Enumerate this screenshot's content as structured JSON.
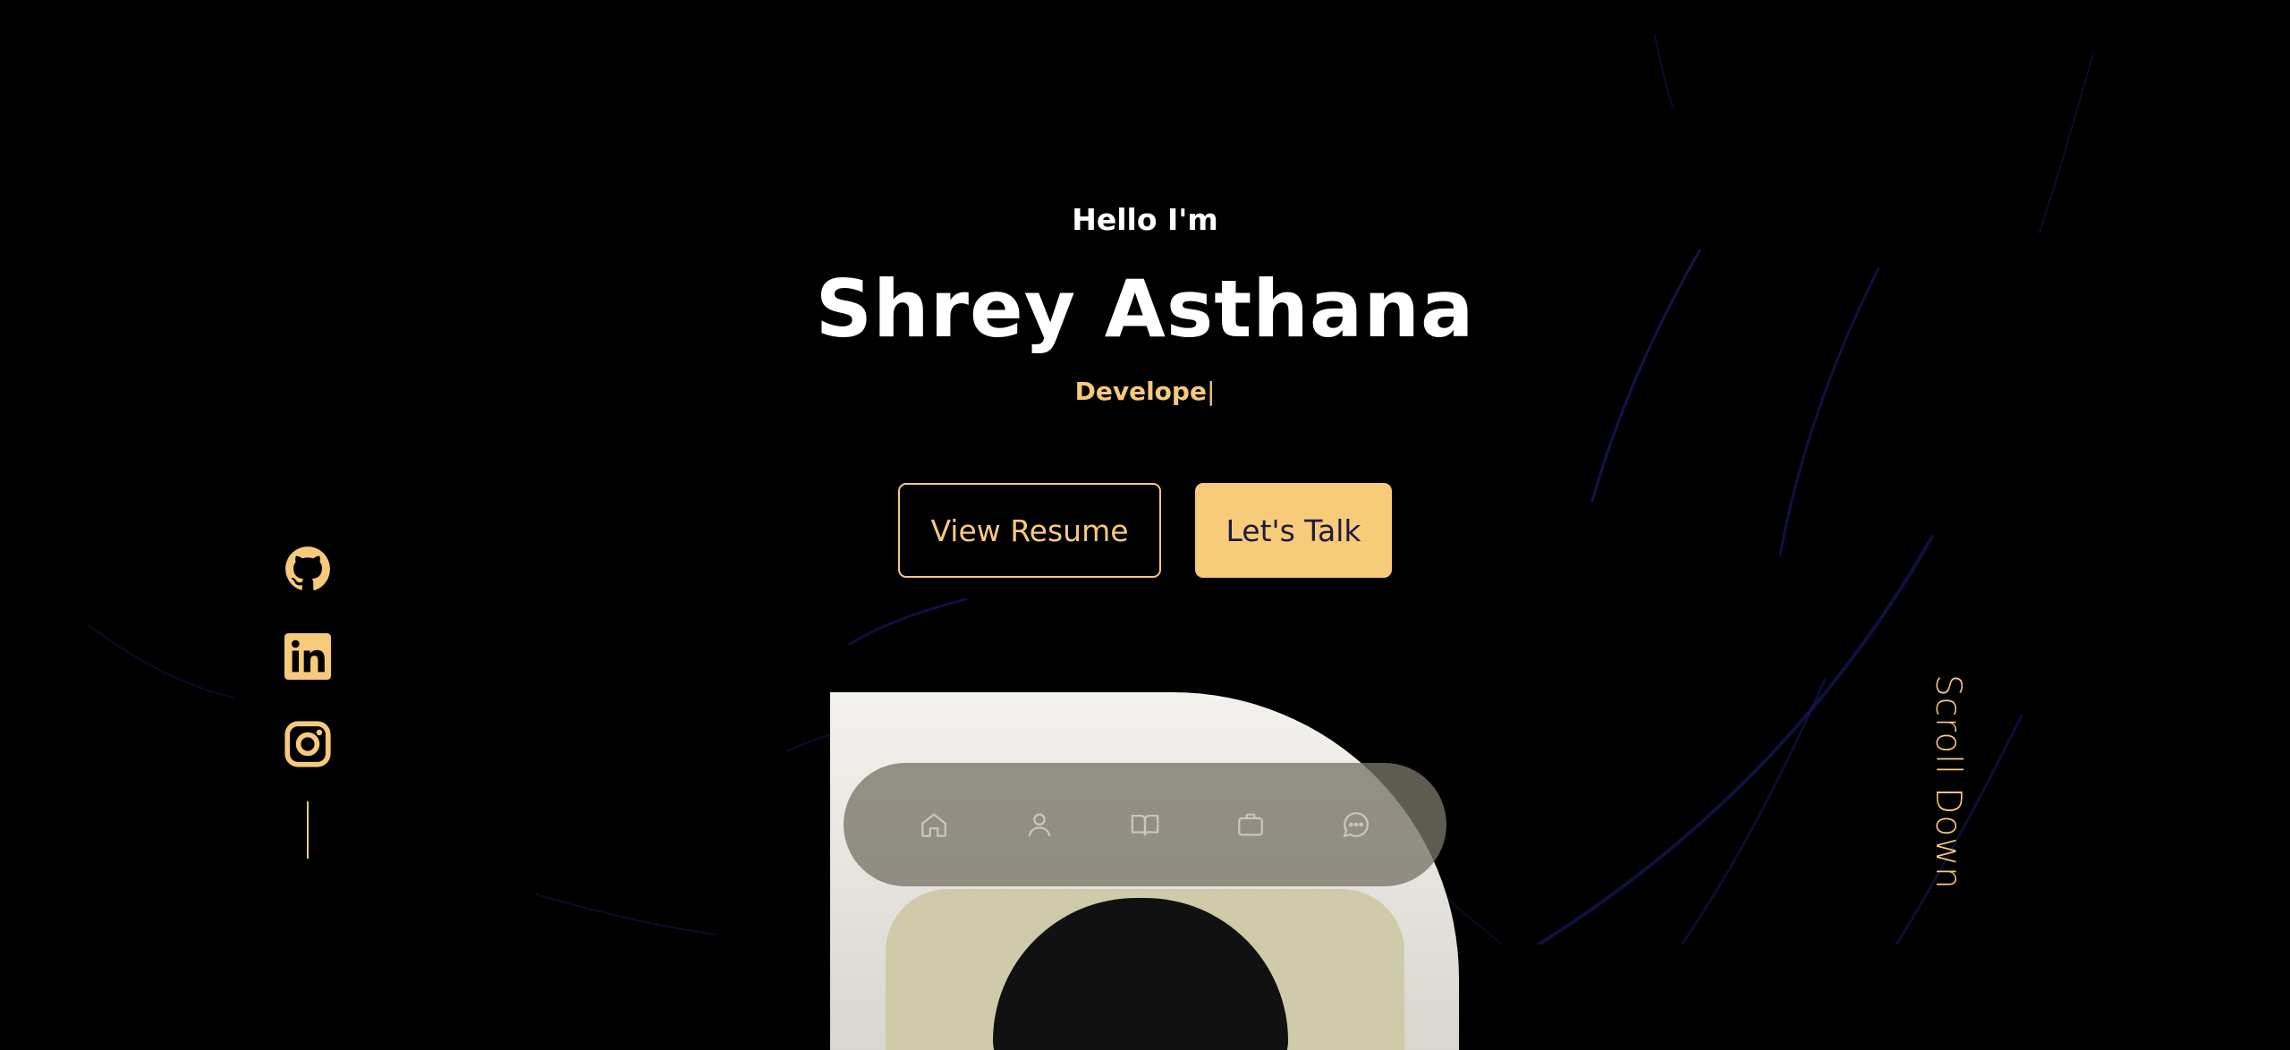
{
  "hero": {
    "greeting": "Hello I'm",
    "name": "Shrey Asthana",
    "role_text": "Develope",
    "cursor": "|"
  },
  "buttons": {
    "view_resume": "View Resume",
    "lets_talk": "Let's Talk"
  },
  "social": [
    {
      "icon": "github-icon"
    },
    {
      "icon": "linkedin-icon"
    },
    {
      "icon": "instagram-icon"
    }
  ],
  "scroll": {
    "label": "Scroll Down"
  },
  "nav": [
    {
      "icon": "home-icon"
    },
    {
      "icon": "user-icon"
    },
    {
      "icon": "book-icon"
    },
    {
      "icon": "briefcase-icon"
    },
    {
      "icon": "chat-icon"
    }
  ],
  "colors": {
    "accent": "#f7c97a",
    "background": "#000000",
    "button_text_dark": "#1c1c3a"
  }
}
